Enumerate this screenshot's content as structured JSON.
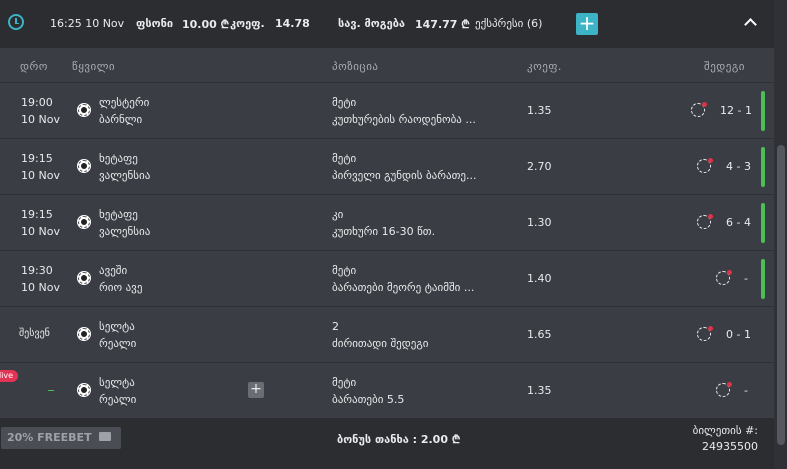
{
  "header": {
    "time": "16:25 10 Nov",
    "stake_label": "ფსონი",
    "stake_value": "10.00 ₾",
    "coef_label": "კოეფ.",
    "coef_value": "14.78",
    "win_label": "სავ. მოგება",
    "win_value": "147.77 ₾",
    "express": "ექსპრესი (6)",
    "add_label": "+"
  },
  "columns": {
    "time": "დრო",
    "pair": "წყვილი",
    "position": "პოზიცია",
    "coef": "კოეფ.",
    "results": "შედეგი"
  },
  "rows": [
    {
      "time": "19:00",
      "date": "10 Nov",
      "home": "ლესტერი",
      "away": "ბარნლი",
      "pick": "მეტი",
      "market": "კუთხურების რაოდენობა ...",
      "coef": "1.35",
      "score": "12 - 1",
      "status": "green"
    },
    {
      "time": "19:15",
      "date": "10 Nov",
      "home": "ხეტაფე",
      "away": "ვალენსია",
      "pick": "მეტი",
      "market": "პირველი გუნდის ბარათე...",
      "coef": "2.70",
      "score": "4 - 3",
      "status": "green"
    },
    {
      "time": "19:15",
      "date": "10 Nov",
      "home": "ხეტაფე",
      "away": "ვალენსია",
      "pick": "კი",
      "market": "კუთხური 16-30 წთ.",
      "coef": "1.30",
      "score": "6 - 4",
      "status": "green"
    },
    {
      "time": "19:30",
      "date": "10 Nov",
      "home": "ავეში",
      "away": "რიო ავე",
      "pick": "მეტი",
      "market": "ბარათები მეორე ტაიმში ...",
      "coef": "1.40",
      "score": "-",
      "status": "green"
    },
    {
      "time": "შესვენ",
      "date": "",
      "home": "სელტა",
      "away": "რეალი",
      "pick": "2",
      "market": "ძირითადი შედეგი",
      "coef": "1.65",
      "score": "0 - 1",
      "status": "none"
    },
    {
      "time": "",
      "date": "",
      "home": "სელტა",
      "away": "რეალი",
      "pick": "მეტი",
      "market": "ბარათები 5.5",
      "coef": "1.35",
      "score": "-",
      "status": "none"
    }
  ],
  "live_badge": "live",
  "footer": {
    "freebet": "20% FREEBET",
    "bonus": "ბონუს თანხა : 2.00 ₾",
    "ticket_label": "ბილეთის #:",
    "ticket_no": "24935500"
  },
  "colors": {
    "accent": "#3db4c6",
    "green": "#4dbd5a",
    "live": "#e23455"
  }
}
